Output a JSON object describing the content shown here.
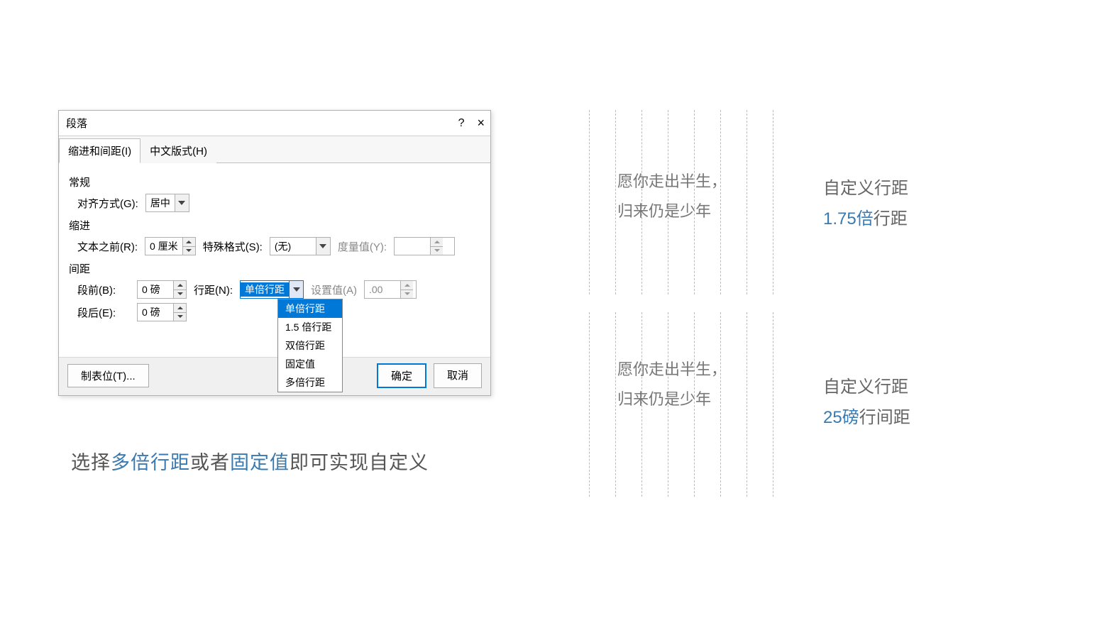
{
  "dialog": {
    "title": "段落",
    "help": "?",
    "close": "×",
    "tabs": {
      "indent": "缩进和间距(I)",
      "chinese": "中文版式(H)"
    },
    "groups": {
      "general": "常规",
      "indent": "缩进",
      "spacing": "间距"
    },
    "labels": {
      "alignment": "对齐方式(G):",
      "alignment_value": "居中",
      "text_before": "文本之前(R):",
      "text_before_value": "0 厘米",
      "special_format": "特殊格式(S):",
      "special_format_value": "(无)",
      "measure_value": "度量值(Y):",
      "before_para": "段前(B):",
      "before_para_value": "0 磅",
      "after_para": "段后(E):",
      "after_para_value": "0 磅",
      "line_spacing": "行距(N):",
      "line_spacing_value": "单倍行距",
      "set_value": "设置值(A)",
      "set_value_num": ".00"
    },
    "dropdown": {
      "opt1": "单倍行距",
      "opt2": "1.5 倍行距",
      "opt3": "双倍行距",
      "opt4": "固定值",
      "opt5": "多倍行距"
    },
    "footer": {
      "tabs_btn": "制表位(T)...",
      "ok": "确定",
      "cancel": "取消"
    }
  },
  "caption": {
    "p1": "选择",
    "h1": "多倍行距",
    "p2": "或者",
    "h2": "固定值",
    "p3": "即可实现自定义"
  },
  "samples": {
    "line1": "愿你走出半生，",
    "line2": "归来仍是少年"
  },
  "annotations": {
    "a1_label": "自定义行距",
    "a1_num": "1.75倍",
    "a1_suffix": "行距",
    "a2_label": "自定义行距",
    "a2_num": "25磅",
    "a2_suffix": "行间距"
  }
}
